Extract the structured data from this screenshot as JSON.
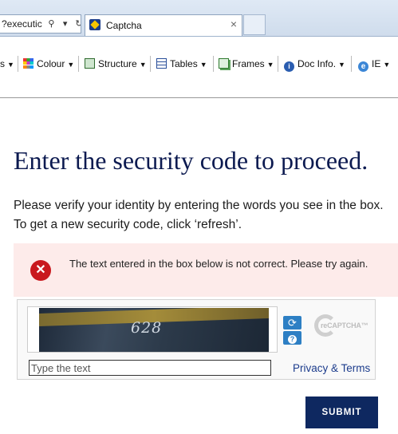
{
  "browser": {
    "address_text": "?executic",
    "tab_title": "Captcha",
    "tab_close": "×"
  },
  "toolbar": {
    "items": [
      {
        "label": "Colour",
        "icon": "colour-icon"
      },
      {
        "label": "Structure",
        "icon": "structure-icon"
      },
      {
        "label": "Tables",
        "icon": "tables-icon"
      },
      {
        "label": "Frames",
        "icon": "frames-icon"
      },
      {
        "label": "Doc Info.",
        "icon": "doc-info-icon"
      },
      {
        "label": "IE",
        "icon": "ie-icon"
      }
    ]
  },
  "page": {
    "headline": "Enter the security code to proceed.",
    "instruction_line1": "Please verify your identity by entering the words you see in the box.",
    "instruction_line2": "To get a new security code, click ‘refresh’."
  },
  "error": {
    "message": "The text entered in the box below is not correct. Please try again.",
    "icon": "error-icon",
    "color": "#c9191e"
  },
  "captcha": {
    "image_text": "628",
    "input_placeholder": "Type the text",
    "privacy_link": "Privacy & Terms",
    "logo_text": "reCAPTCHA™"
  },
  "submit_label": "SUBMIT",
  "colors": {
    "headline": "#0c1a50",
    "submit_background": "#0e2860",
    "error_background": "#fdebea"
  }
}
